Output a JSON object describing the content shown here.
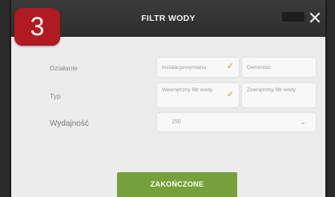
{
  "step_badge": "3",
  "header": {
    "title": "FILTR WODY",
    "close_symbol": "✕"
  },
  "form": {
    "dzialanie": {
      "label": "Działanie",
      "options": [
        {
          "label": "Instalacja/wymiana",
          "selected": true
        },
        {
          "label": "Demontaż",
          "selected": false
        }
      ]
    },
    "typ": {
      "label": "Typ",
      "options": [
        {
          "label": "Wewnętrzny filtr wody",
          "selected": true
        },
        {
          "label": "Zewnętrzny filtr wody",
          "selected": false
        }
      ]
    },
    "wydajnosc": {
      "label": "Wydajność",
      "value": "150"
    }
  },
  "check_symbol": "✓",
  "dropdown_symbol": "⌄",
  "finish_button": "ZAKOŃCZONE",
  "colors": {
    "header_bg": "#333333",
    "badge": "#b11a22",
    "accent_check": "#d98a3a",
    "finish_button": "#76a13a"
  }
}
